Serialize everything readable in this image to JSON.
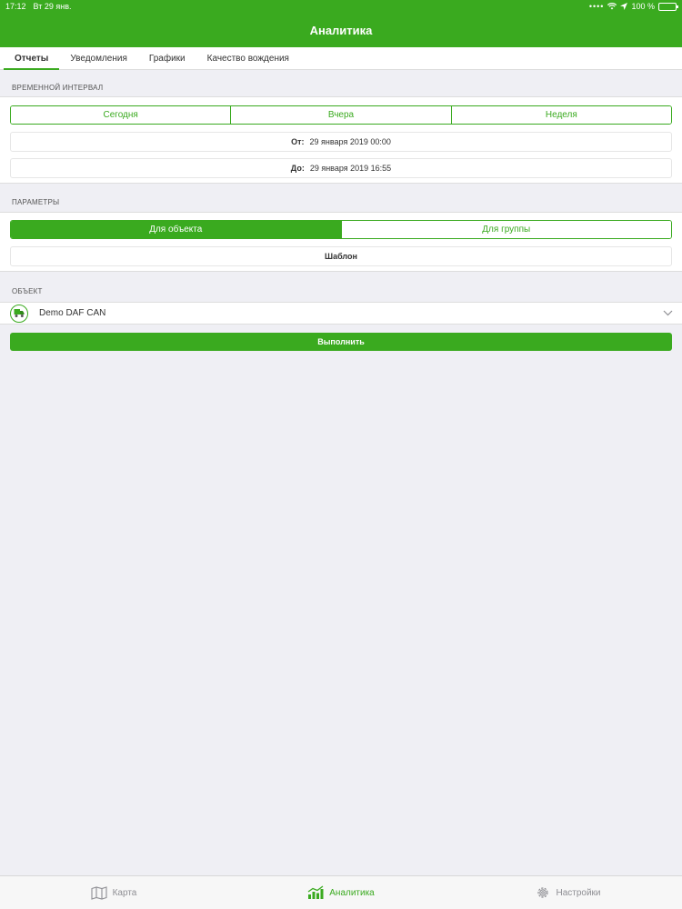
{
  "status_bar": {
    "time": "17:12",
    "date": "Вт 29 янв.",
    "battery": "100 %"
  },
  "nav": {
    "title": "Аналитика"
  },
  "tabs": [
    {
      "label": "Отчеты",
      "active": true
    },
    {
      "label": "Уведомления",
      "active": false
    },
    {
      "label": "Графики",
      "active": false
    },
    {
      "label": "Качество вождения",
      "active": false
    }
  ],
  "interval": {
    "header": "ВРЕМЕННОЙ ИНТЕРВАЛ",
    "options": [
      "Сегодня",
      "Вчера",
      "Неделя"
    ],
    "from_label": "От:",
    "from_value": "29 января 2019 00:00",
    "to_label": "До:",
    "to_value": "29 января 2019 16:55"
  },
  "params": {
    "header": "ПАРАМЕТРЫ",
    "options": [
      "Для объекта",
      "Для группы"
    ],
    "selected": "Для объекта",
    "template_label": "Шаблон"
  },
  "object": {
    "header": "ОБЪЕКТ",
    "name": "Demo DAF CAN",
    "icon": "truck-icon"
  },
  "run_label": "Выполнить",
  "tab_bar": [
    {
      "label": "Карта",
      "icon": "map-icon",
      "active": false
    },
    {
      "label": "Аналитика",
      "icon": "analytics-icon",
      "active": true
    },
    {
      "label": "Настройки",
      "icon": "gear-icon",
      "active": false
    }
  ],
  "colors": {
    "accent": "#3aaa1f",
    "background": "#efeff4"
  }
}
